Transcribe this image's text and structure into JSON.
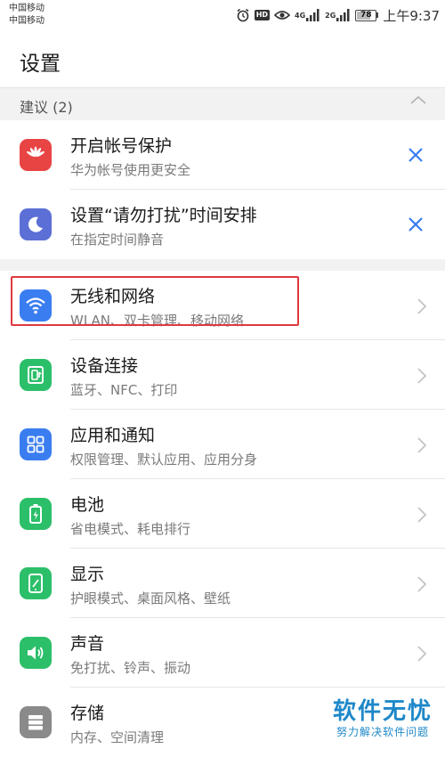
{
  "status_bar": {
    "carrier_1": "中国移动",
    "carrier_2": "中国移动",
    "hd": "HD",
    "net_1": "4G",
    "net_2": "2G",
    "battery": "78",
    "battery_level_percent": 78,
    "time": "上午9:37"
  },
  "page_title": "设置",
  "suggestions": {
    "label": "建议 (2)",
    "items": [
      {
        "title": "开启帐号保护",
        "subtitle": "华为帐号使用更安全",
        "icon": "huawei-logo-icon",
        "color": "#e84444"
      },
      {
        "title": "设置“请勿打扰”时间安排",
        "subtitle": "在指定时间静音",
        "icon": "moon-icon",
        "color": "#5b6fd6"
      }
    ]
  },
  "settings": {
    "items": [
      {
        "title": "无线和网络",
        "subtitle": "WLAN、双卡管理、移动网络",
        "icon": "wifi-icon",
        "color": "#3a7df0"
      },
      {
        "title": "设备连接",
        "subtitle": "蓝牙、NFC、打印",
        "icon": "device-connection-icon",
        "color": "#2cbf6a"
      },
      {
        "title": "应用和通知",
        "subtitle": "权限管理、默认应用、应用分身",
        "icon": "apps-grid-icon",
        "color": "#3a7df0"
      },
      {
        "title": "电池",
        "subtitle": "省电模式、耗电排行",
        "icon": "battery-icon",
        "color": "#2cbf6a"
      },
      {
        "title": "显示",
        "subtitle": "护眼模式、桌面风格、壁纸",
        "icon": "display-icon",
        "color": "#2cbf6a"
      },
      {
        "title": "声音",
        "subtitle": "免打扰、铃声、振动",
        "icon": "speaker-icon",
        "color": "#2cbf6a"
      },
      {
        "title": "存储",
        "subtitle": "内存、空间清理",
        "icon": "storage-icon",
        "color": "#8a8a8a"
      }
    ]
  },
  "watermark": {
    "main": "软件无忧",
    "sub": "努力解决软件问题"
  }
}
